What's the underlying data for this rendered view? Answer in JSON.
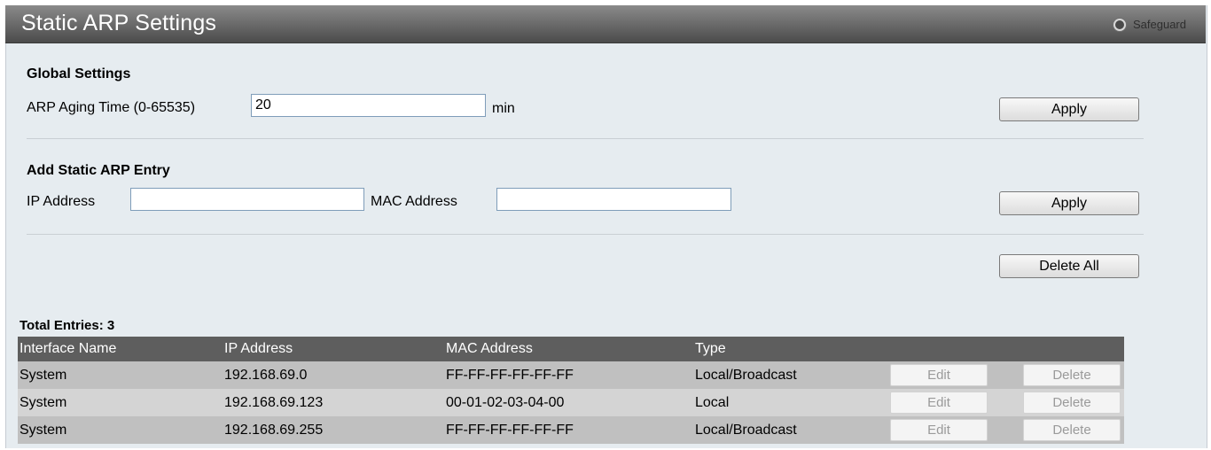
{
  "header": {
    "title": "Static ARP Settings",
    "safeguard": "Safeguard"
  },
  "global": {
    "heading": "Global Settings",
    "aging_label": "ARP Aging Time (0-65535)",
    "aging_value": "20",
    "unit": "min",
    "apply": "Apply"
  },
  "add": {
    "heading": "Add Static ARP Entry",
    "ip_label": "IP Address",
    "ip_value": "",
    "mac_label": "MAC Address",
    "mac_value": "",
    "apply": "Apply"
  },
  "delete_all": "Delete All",
  "table": {
    "total": "Total Entries: 3",
    "headers": [
      "Interface Name",
      "IP Address",
      "MAC Address",
      "Type"
    ],
    "rows": [
      {
        "iface": "System",
        "ip": "192.168.69.0",
        "mac": "FF-FF-FF-FF-FF-FF",
        "type": "Local/Broadcast",
        "edit": "Edit",
        "del": "Delete"
      },
      {
        "iface": "System",
        "ip": "192.168.69.123",
        "mac": "00-01-02-03-04-00",
        "type": "Local",
        "edit": "Edit",
        "del": "Delete"
      },
      {
        "iface": "System",
        "ip": "192.168.69.255",
        "mac": "FF-FF-FF-FF-FF-FF",
        "type": "Local/Broadcast",
        "edit": "Edit",
        "del": "Delete"
      }
    ]
  },
  "colors": {
    "header_bar": "#5e5e5e",
    "panel": "#e6ecf0",
    "row_dark": "#c0c0c0",
    "row_light": "#d4d4d4"
  }
}
